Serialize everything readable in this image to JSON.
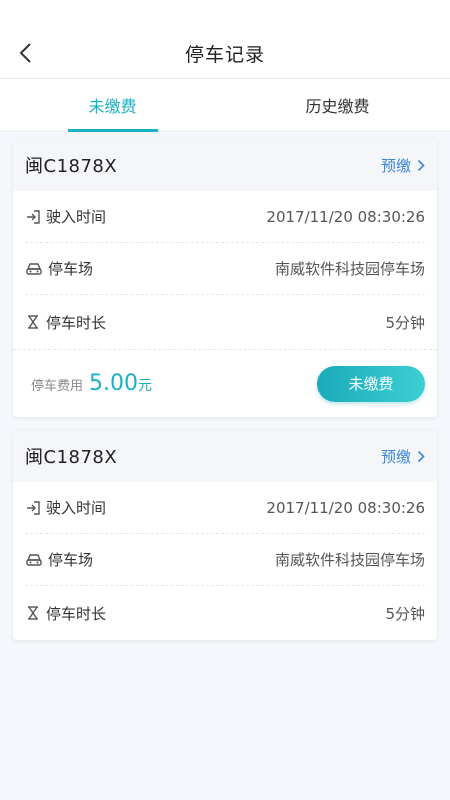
{
  "nav": {
    "title": "停车记录"
  },
  "tabs": [
    {
      "label": "未缴费",
      "active": true
    },
    {
      "label": "历史缴费",
      "active": false
    }
  ],
  "accent_color": "#1ab1c6",
  "link_color": "#3a86d8",
  "records": [
    {
      "plate": "闽C1878X",
      "prepay_label": "预缴",
      "rows": [
        {
          "icon": "entry-icon",
          "label": "驶入时间",
          "value": "2017/11/20 08:30:26"
        },
        {
          "icon": "car-icon",
          "label": "停车场",
          "value": "南威软件科技园停车场"
        },
        {
          "icon": "hourglass-icon",
          "label": "停车时长",
          "value": "5分钟"
        }
      ],
      "fee_label": "停车费用",
      "fee_amount": "5.00",
      "fee_unit": "元",
      "pay_button": "未缴费"
    },
    {
      "plate": "闽C1878X",
      "prepay_label": "预缴",
      "rows": [
        {
          "icon": "entry-icon",
          "label": "驶入时间",
          "value": "2017/11/20 08:30:26"
        },
        {
          "icon": "car-icon",
          "label": "停车场",
          "value": "南威软件科技园停车场"
        },
        {
          "icon": "hourglass-icon",
          "label": "停车时长",
          "value": "5分钟"
        }
      ]
    }
  ]
}
